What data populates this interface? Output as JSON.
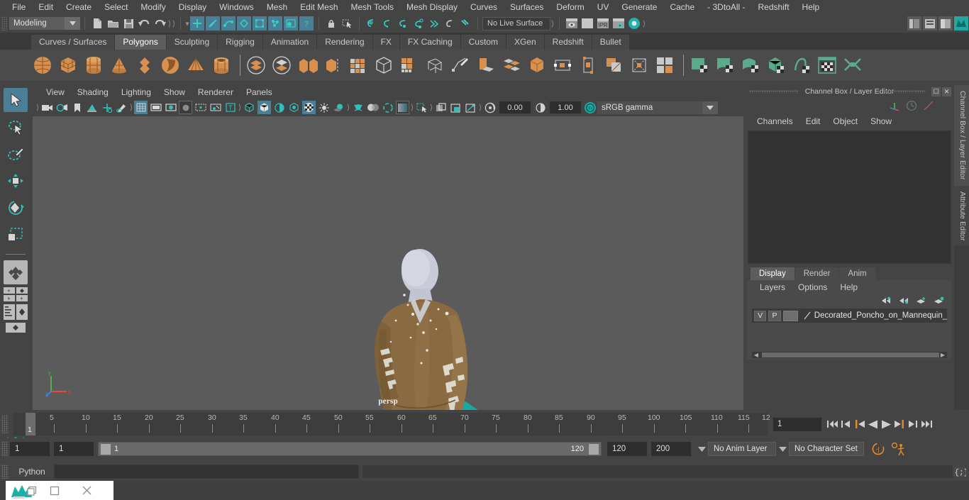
{
  "menubar": {
    "items": [
      "File",
      "Edit",
      "Create",
      "Select",
      "Modify",
      "Display",
      "Windows",
      "Mesh",
      "Edit Mesh",
      "Mesh Tools",
      "Mesh Display",
      "Curves",
      "Surfaces",
      "Deform",
      "UV",
      "Generate",
      "Cache",
      "- 3DtoAll -",
      "Redshift",
      "Help"
    ]
  },
  "statusline": {
    "menuset": "Modeling",
    "live_surface": "No Live Surface",
    "icons": [
      "new-scene-icon",
      "open-scene-icon",
      "save-scene-icon",
      "undo-icon",
      "redo-icon",
      "select-by-hierarchy-icon",
      "select-by-object-icon",
      "select-by-component-icon",
      "snap-to-grid-icon",
      "snap-to-curve-icon",
      "snap-to-point-icon",
      "snap-to-projected-center-icon",
      "snap-to-view-plane-icon",
      "make-live-icon",
      "lock-icon",
      "select-tool-icon",
      "render-current-frame-icon",
      "ipr-render-icon",
      "render-settings-icon",
      "hypershade-icon"
    ]
  },
  "shelf": {
    "tabs": [
      "Curves / Surfaces",
      "Polygons",
      "Sculpting",
      "Rigging",
      "Animation",
      "Rendering",
      "FX",
      "FX Caching",
      "Custom",
      "XGen",
      "Redshift",
      "Bullet"
    ],
    "active_tab": "Polygons",
    "icon_names": [
      "poly-sphere",
      "poly-cube",
      "poly-cylinder",
      "poly-cone",
      "poly-torus",
      "poly-prism",
      "poly-pyramid",
      "poly-pipe",
      "poly-combine",
      "poly-separate",
      "poly-extrude",
      "poly-bevel",
      "poly-bridge",
      "poly-append",
      "poly-mirror",
      "poly-smooth",
      "poly-booleans",
      "poly-reduce",
      "poly-triangulate",
      "poly-quadrangulate",
      "poly-crease",
      "poly-sculpt",
      "poly-multicut",
      "uv-planar",
      "uv-cylindrical",
      "uv-spherical",
      "uv-automatic",
      "uv-unfold",
      "uv-editor",
      "uv-layout"
    ]
  },
  "toolbox": {
    "tools": [
      "select-tool",
      "lasso-select-tool",
      "paint-select-tool",
      "move-tool",
      "rotate-tool",
      "scale-tool",
      "last-tool"
    ],
    "active_tool": "select-tool",
    "layouts": [
      "single-pane-layout",
      "two-pane-layout",
      "four-pane-layout",
      "outliner-persp-layout",
      "hypershade-layout"
    ]
  },
  "viewport": {
    "menus": [
      "View",
      "Shading",
      "Lighting",
      "Show",
      "Renderer",
      "Panels"
    ],
    "camera_label": "persp",
    "exposure": "0.00",
    "gamma": "1.00",
    "color_management": "sRGB gamma",
    "gamma_toggle": "ON",
    "toolbar_icons": [
      "select-camera-icon",
      "camera-attributes-icon",
      "bookmark-icon",
      "image-plane-icon",
      "two-d-pan-zoom-icon",
      "grease-pencil-icon",
      "grid-icon",
      "film-gate-icon",
      "resolution-gate-icon",
      "gate-mask-icon",
      "film-origin-icon",
      "xray-icon",
      "texture-mode-icon",
      "wireframe-icon",
      "smooth-shade-icon",
      "flat-shade-icon",
      "shaded-textured-icon",
      "lighting-icon",
      "shadows-icon",
      "ambient-occlusion-icon",
      "motion-blur-icon",
      "multisample-icon",
      "isolate-select-icon",
      "xray-joints-icon",
      "xray-active-icon",
      "viewport-snapshot-icon",
      "exposure-icon",
      "gamma-icon"
    ],
    "scene": {
      "object": "Decorated Poncho on Mannequin",
      "poncho_color": "#8a6a41",
      "mannequin_color": "#c5c8d4",
      "floor_color": "#16aaa6",
      "background_color": "#5b5b5b"
    }
  },
  "rightpanel": {
    "title": "Channel Box / Layer Editor",
    "menus": [
      "Channels",
      "Edit",
      "Object",
      "Show"
    ],
    "window_buttons": [
      "undock-icon",
      "close-icon"
    ],
    "header_icons": [
      "axis-gizmo-icon",
      "clock-icon",
      "curve-icon"
    ],
    "layer_editor": {
      "tabs": [
        "Display",
        "Render",
        "Anim"
      ],
      "active_tab": "Display",
      "menus": [
        "Layers",
        "Options",
        "Help"
      ],
      "toolbar_icons": [
        "move-layer-up-icon",
        "move-layer-down-icon",
        "new-layer-icon",
        "new-layer-from-selected-icon"
      ],
      "layers": [
        {
          "visibility": "V",
          "playback": "P",
          "color_swatch": "",
          "name": "Decorated_Poncho_on_Mannequin_C"
        }
      ]
    },
    "vertical_tabs": [
      "Channel Box / Layer Editor",
      "Attribute Editor"
    ]
  },
  "timeline": {
    "tick_labels": [
      "5",
      "10",
      "15",
      "20",
      "25",
      "30",
      "35",
      "40",
      "45",
      "50",
      "55",
      "60",
      "65",
      "70",
      "75",
      "80",
      "85",
      "90",
      "95",
      "100",
      "105",
      "110",
      "115",
      "12"
    ],
    "current_frame_marker": "1",
    "current_frame_field": "1",
    "playback_buttons": [
      "go-to-start-icon",
      "step-back-keyframe-icon",
      "step-back-frame-icon",
      "play-backwards-icon",
      "play-forwards-icon",
      "step-forward-frame-icon",
      "step-forward-keyframe-icon",
      "go-to-end-icon"
    ]
  },
  "range": {
    "start_field": "1",
    "range_start_field": "1",
    "slider_start": "1",
    "slider_end": "120",
    "range_end_field": "120",
    "end_field": "200",
    "anim_layer": "No Anim Layer",
    "character_set": "No Character Set",
    "right_icons": [
      "auto-keyframe-icon",
      "animation-preferences-icon"
    ]
  },
  "commandline": {
    "language_label": "Python",
    "input_value": "",
    "script_editor_icon": "script-editor-icon"
  },
  "taskbar": {
    "items": [
      "maya-app-icon",
      "restore-window-icon",
      "maximize-window-icon",
      "close-window-icon"
    ]
  }
}
